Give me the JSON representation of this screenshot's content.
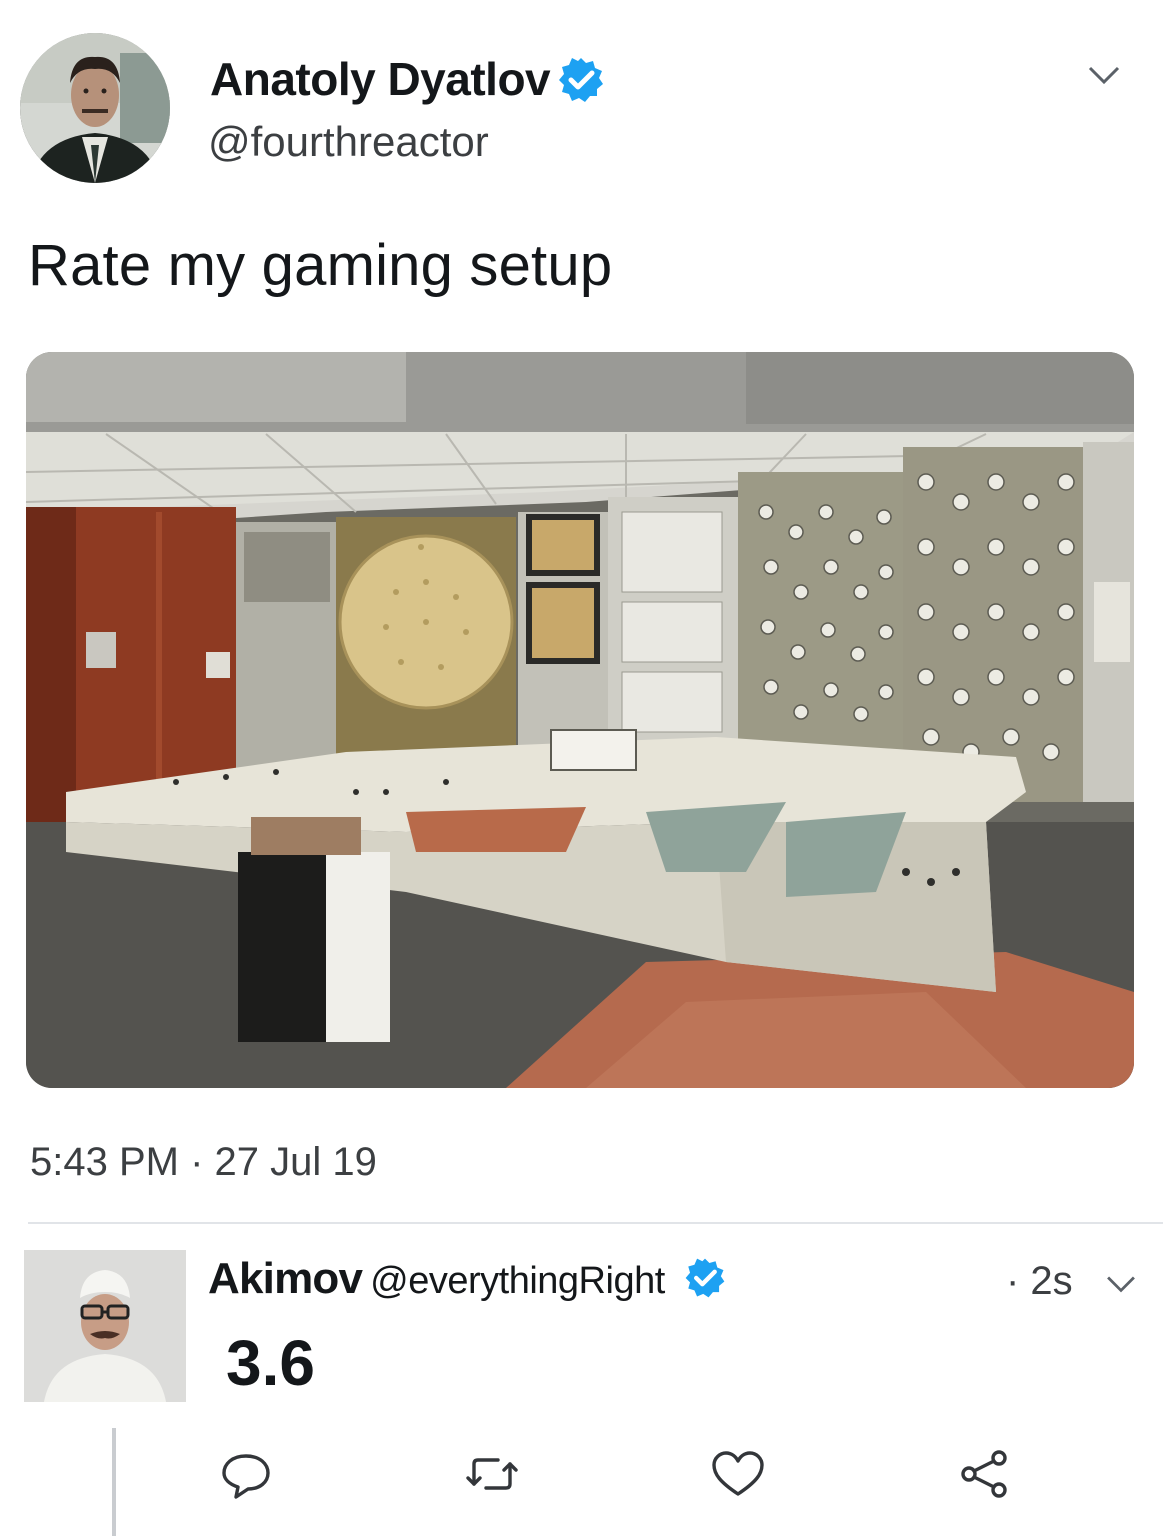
{
  "tweet": {
    "author": {
      "display_name": "Anatoly Dyatlov",
      "handle": "@fourthreactor",
      "verified": true,
      "avatar_icon": "avatar-photo"
    },
    "text": "Rate my gaming setup",
    "media": {
      "kind": "photo",
      "subject": "nuclear reactor control room"
    },
    "timestamp": "5:43 PM · 27 Jul 19"
  },
  "reply": {
    "author": {
      "display_name": "Akimov",
      "handle": "@everythingRight",
      "verified": true,
      "avatar_icon": "avatar-photo"
    },
    "time": "· 2s",
    "text": "3.6",
    "actions": [
      "reply-icon",
      "retweet-icon",
      "like-icon",
      "share-icon"
    ]
  },
  "colors": {
    "verified": "#1da1f2",
    "text": "#14171a",
    "muted": "#3c3f42",
    "divider": "#e1e4e8"
  }
}
